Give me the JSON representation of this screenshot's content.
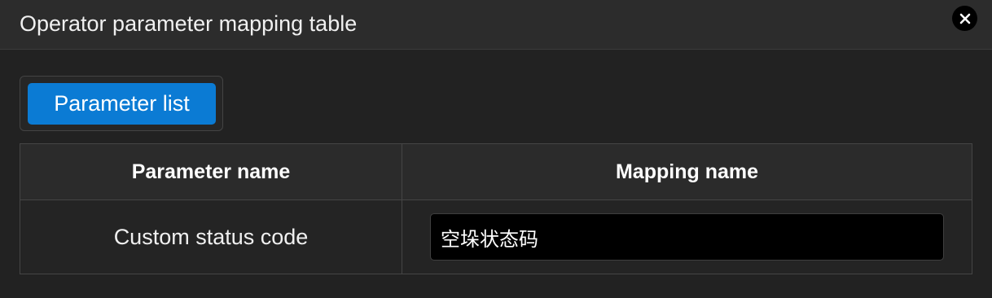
{
  "dialog": {
    "title": "Operator parameter mapping table",
    "close_icon": "close-icon"
  },
  "tabs": [
    {
      "label": "Parameter list",
      "active": true
    }
  ],
  "table": {
    "headers": [
      "Parameter name",
      "Mapping name"
    ],
    "rows": [
      {
        "parameter_name": "Custom status code",
        "mapping_name": "空垛状态码"
      }
    ]
  },
  "colors": {
    "background": "#222222",
    "titlebar": "#2c2c2c",
    "accent": "#0b7bd4",
    "input_background": "#000000"
  }
}
